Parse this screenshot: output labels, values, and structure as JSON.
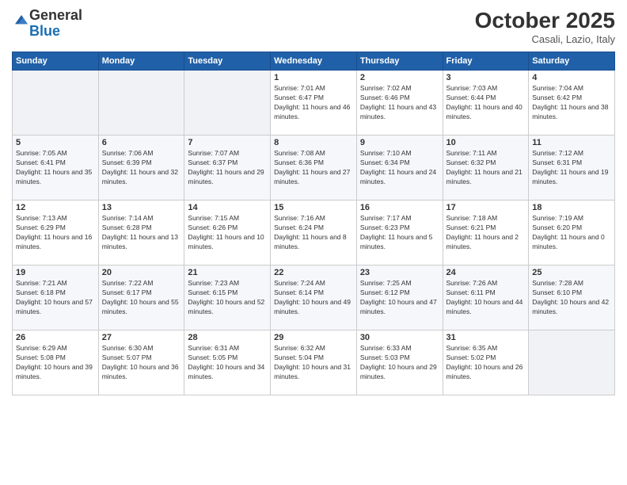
{
  "logo": {
    "general": "General",
    "blue": "Blue"
  },
  "header": {
    "month": "October 2025",
    "location": "Casali, Lazio, Italy"
  },
  "weekdays": [
    "Sunday",
    "Monday",
    "Tuesday",
    "Wednesday",
    "Thursday",
    "Friday",
    "Saturday"
  ],
  "weeks": [
    [
      {
        "day": "",
        "info": ""
      },
      {
        "day": "",
        "info": ""
      },
      {
        "day": "",
        "info": ""
      },
      {
        "day": "1",
        "info": "Sunrise: 7:01 AM\nSunset: 6:47 PM\nDaylight: 11 hours and 46 minutes."
      },
      {
        "day": "2",
        "info": "Sunrise: 7:02 AM\nSunset: 6:46 PM\nDaylight: 11 hours and 43 minutes."
      },
      {
        "day": "3",
        "info": "Sunrise: 7:03 AM\nSunset: 6:44 PM\nDaylight: 11 hours and 40 minutes."
      },
      {
        "day": "4",
        "info": "Sunrise: 7:04 AM\nSunset: 6:42 PM\nDaylight: 11 hours and 38 minutes."
      }
    ],
    [
      {
        "day": "5",
        "info": "Sunrise: 7:05 AM\nSunset: 6:41 PM\nDaylight: 11 hours and 35 minutes."
      },
      {
        "day": "6",
        "info": "Sunrise: 7:06 AM\nSunset: 6:39 PM\nDaylight: 11 hours and 32 minutes."
      },
      {
        "day": "7",
        "info": "Sunrise: 7:07 AM\nSunset: 6:37 PM\nDaylight: 11 hours and 29 minutes."
      },
      {
        "day": "8",
        "info": "Sunrise: 7:08 AM\nSunset: 6:36 PM\nDaylight: 11 hours and 27 minutes."
      },
      {
        "day": "9",
        "info": "Sunrise: 7:10 AM\nSunset: 6:34 PM\nDaylight: 11 hours and 24 minutes."
      },
      {
        "day": "10",
        "info": "Sunrise: 7:11 AM\nSunset: 6:32 PM\nDaylight: 11 hours and 21 minutes."
      },
      {
        "day": "11",
        "info": "Sunrise: 7:12 AM\nSunset: 6:31 PM\nDaylight: 11 hours and 19 minutes."
      }
    ],
    [
      {
        "day": "12",
        "info": "Sunrise: 7:13 AM\nSunset: 6:29 PM\nDaylight: 11 hours and 16 minutes."
      },
      {
        "day": "13",
        "info": "Sunrise: 7:14 AM\nSunset: 6:28 PM\nDaylight: 11 hours and 13 minutes."
      },
      {
        "day": "14",
        "info": "Sunrise: 7:15 AM\nSunset: 6:26 PM\nDaylight: 11 hours and 10 minutes."
      },
      {
        "day": "15",
        "info": "Sunrise: 7:16 AM\nSunset: 6:24 PM\nDaylight: 11 hours and 8 minutes."
      },
      {
        "day": "16",
        "info": "Sunrise: 7:17 AM\nSunset: 6:23 PM\nDaylight: 11 hours and 5 minutes."
      },
      {
        "day": "17",
        "info": "Sunrise: 7:18 AM\nSunset: 6:21 PM\nDaylight: 11 hours and 2 minutes."
      },
      {
        "day": "18",
        "info": "Sunrise: 7:19 AM\nSunset: 6:20 PM\nDaylight: 11 hours and 0 minutes."
      }
    ],
    [
      {
        "day": "19",
        "info": "Sunrise: 7:21 AM\nSunset: 6:18 PM\nDaylight: 10 hours and 57 minutes."
      },
      {
        "day": "20",
        "info": "Sunrise: 7:22 AM\nSunset: 6:17 PM\nDaylight: 10 hours and 55 minutes."
      },
      {
        "day": "21",
        "info": "Sunrise: 7:23 AM\nSunset: 6:15 PM\nDaylight: 10 hours and 52 minutes."
      },
      {
        "day": "22",
        "info": "Sunrise: 7:24 AM\nSunset: 6:14 PM\nDaylight: 10 hours and 49 minutes."
      },
      {
        "day": "23",
        "info": "Sunrise: 7:25 AM\nSunset: 6:12 PM\nDaylight: 10 hours and 47 minutes."
      },
      {
        "day": "24",
        "info": "Sunrise: 7:26 AM\nSunset: 6:11 PM\nDaylight: 10 hours and 44 minutes."
      },
      {
        "day": "25",
        "info": "Sunrise: 7:28 AM\nSunset: 6:10 PM\nDaylight: 10 hours and 42 minutes."
      }
    ],
    [
      {
        "day": "26",
        "info": "Sunrise: 6:29 AM\nSunset: 5:08 PM\nDaylight: 10 hours and 39 minutes."
      },
      {
        "day": "27",
        "info": "Sunrise: 6:30 AM\nSunset: 5:07 PM\nDaylight: 10 hours and 36 minutes."
      },
      {
        "day": "28",
        "info": "Sunrise: 6:31 AM\nSunset: 5:05 PM\nDaylight: 10 hours and 34 minutes."
      },
      {
        "day": "29",
        "info": "Sunrise: 6:32 AM\nSunset: 5:04 PM\nDaylight: 10 hours and 31 minutes."
      },
      {
        "day": "30",
        "info": "Sunrise: 6:33 AM\nSunset: 5:03 PM\nDaylight: 10 hours and 29 minutes."
      },
      {
        "day": "31",
        "info": "Sunrise: 6:35 AM\nSunset: 5:02 PM\nDaylight: 10 hours and 26 minutes."
      },
      {
        "day": "",
        "info": ""
      }
    ]
  ]
}
